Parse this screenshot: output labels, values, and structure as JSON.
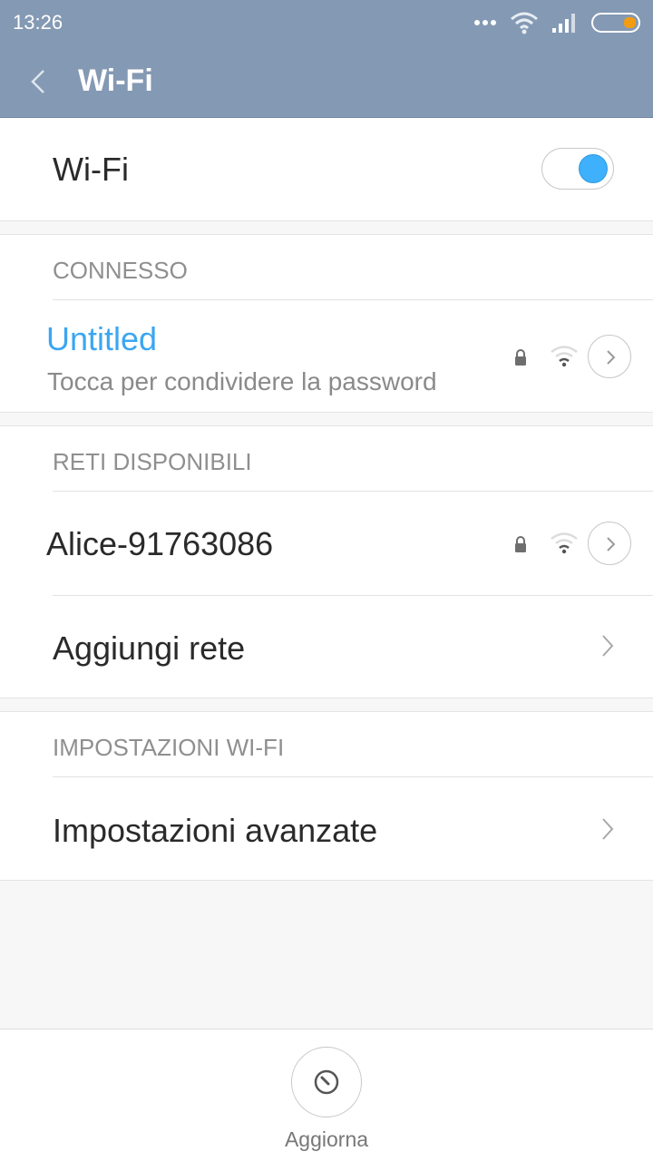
{
  "status_bar": {
    "time": "13:26",
    "icons": [
      "more-dots-icon",
      "wifi-signal-icon",
      "cell-signal-icon",
      "battery-icon"
    ],
    "battery_accent": "#f39c12"
  },
  "title_bar": {
    "title": "Wi-Fi",
    "color": "#8499b3"
  },
  "wifi_toggle": {
    "label": "Wi-Fi",
    "enabled": true,
    "accent": "#3fb0fb"
  },
  "connected": {
    "header": "CONNESSO",
    "network": {
      "name": "Untitled",
      "subtitle": "Tocca per condividere la password",
      "secured": true,
      "name_color": "#3ba6f2"
    }
  },
  "available": {
    "header": "RETI DISPONIBILI",
    "networks": [
      {
        "name": "Alice-91763086",
        "secured": true
      }
    ],
    "add_network": "Aggiungi rete"
  },
  "settings": {
    "header": "IMPOSTAZIONI WI-FI",
    "advanced": "Impostazioni avanzate"
  },
  "bottom": {
    "refresh_label": "Aggiorna"
  }
}
